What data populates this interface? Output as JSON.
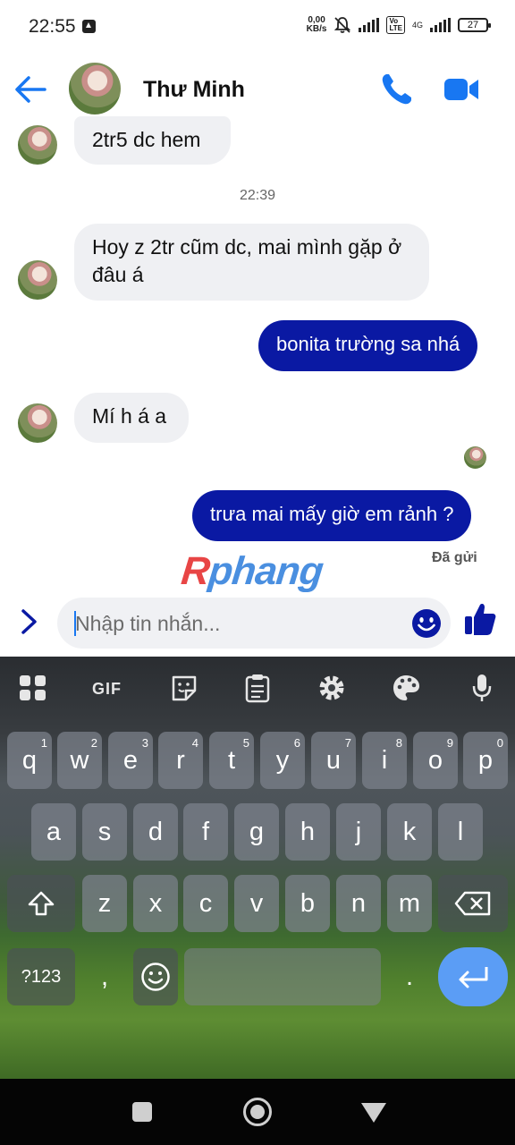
{
  "status_bar": {
    "time": "22:55",
    "net_speed_value": "0,00",
    "net_speed_unit": "KB/s",
    "network_label": "4G",
    "battery": "27"
  },
  "header": {
    "contact_name": "Thư Minh"
  },
  "messages": [
    {
      "direction": "incoming",
      "text": "2tr5 dc hem"
    },
    {
      "direction": "incoming",
      "text": "Hoy z 2tr cũm dc, mai mình gặp ở đâu á"
    },
    {
      "direction": "outgoing",
      "text": "bonita trường sa nhá"
    },
    {
      "direction": "incoming",
      "text": "Mí h á a"
    },
    {
      "direction": "outgoing",
      "text": "trưa mai mấy giờ em rảnh ?"
    }
  ],
  "timestamp": "22:39",
  "sent_status": "Đã gửi",
  "watermark": {
    "first": "R",
    "rest": "phang"
  },
  "composer": {
    "placeholder": "Nhập tin nhắn..."
  },
  "keyboard": {
    "toolbar_gif": "GIF",
    "row1": [
      {
        "key": "q",
        "hint": "1"
      },
      {
        "key": "w",
        "hint": "2"
      },
      {
        "key": "e",
        "hint": "3"
      },
      {
        "key": "r",
        "hint": "4"
      },
      {
        "key": "t",
        "hint": "5"
      },
      {
        "key": "y",
        "hint": "6"
      },
      {
        "key": "u",
        "hint": "7"
      },
      {
        "key": "i",
        "hint": "8"
      },
      {
        "key": "o",
        "hint": "9"
      },
      {
        "key": "p",
        "hint": "0"
      }
    ],
    "row2": [
      "a",
      "s",
      "d",
      "f",
      "g",
      "h",
      "j",
      "k",
      "l"
    ],
    "row3": [
      "z",
      "x",
      "c",
      "v",
      "b",
      "n",
      "m"
    ],
    "symbols_label": "?123",
    "comma": ",",
    "period": "."
  },
  "colors": {
    "accent": "#1877f2",
    "outgoing_bubble": "#0a19a3",
    "incoming_bubble": "#eff0f3",
    "enter_key": "#5b9df5"
  }
}
